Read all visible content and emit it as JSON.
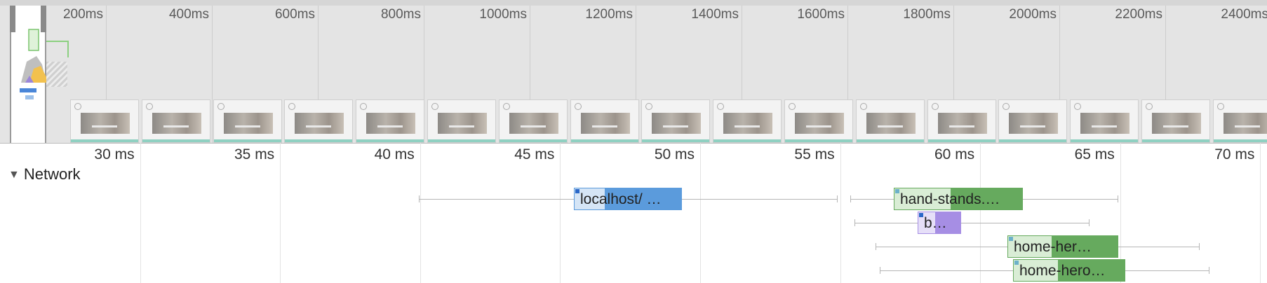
{
  "overview": {
    "tick_labels": [
      "200ms",
      "400ms",
      "600ms",
      "800ms",
      "1000ms",
      "1200ms",
      "1400ms",
      "1600ms",
      "1800ms",
      "2000ms",
      "2200ms",
      "2400ms"
    ],
    "filmstrip_frames": 17
  },
  "ruler": {
    "labels": [
      "30 ms",
      "35 ms",
      "40 ms",
      "45 ms",
      "50 ms",
      "55 ms",
      "60 ms",
      "65 ms",
      "70 ms"
    ]
  },
  "network": {
    "section_label": "Network",
    "requests": [
      {
        "label": "localhost/ …",
        "color": "#5b9bdc",
        "light": "#d5e5f6",
        "icon": "#2a68c8"
      },
      {
        "label": "hand-stands.…",
        "color": "#66aa5e",
        "light": "#d9edd5",
        "icon": "#6cb1c9"
      },
      {
        "label": "b…",
        "color": "#a68ee4",
        "light": "#e6dff8",
        "icon": "#2a68c8"
      },
      {
        "label": "home-her…",
        "color": "#66aa5e",
        "light": "#d9edd5",
        "icon": "#6cb1c9"
      },
      {
        "label": "home-hero…",
        "color": "#66aa5e",
        "light": "#d9edd5",
        "icon": "#6cb1c9"
      }
    ]
  }
}
